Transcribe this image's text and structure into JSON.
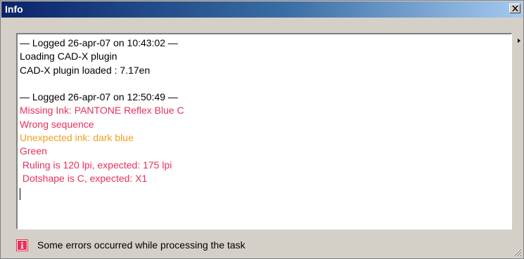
{
  "window": {
    "title": "Info",
    "close_icon": "close-x-icon"
  },
  "log": {
    "lines": [
      {
        "text": "— Logged 26-apr-07 on 10:43:02 —",
        "color": "#000000"
      },
      {
        "text": "Loading CAD-X plugin",
        "color": "#000000"
      },
      {
        "text": "CAD-X plugin loaded : 7.17en",
        "color": "#000000"
      },
      {
        "text": "",
        "color": "#000000"
      },
      {
        "text": "— Logged 26-apr-07 on 12:50:49 —",
        "color": "#000000"
      },
      {
        "text": "Missing Ink: PANTONE Reflex Blue C",
        "color": "#e8305a"
      },
      {
        "text": "Wrong sequence",
        "color": "#e8305a"
      },
      {
        "text": "Unexpected ink: dark blue",
        "color": "#f0a020"
      },
      {
        "text": "Green",
        "color": "#e8305a"
      },
      {
        "text": " Ruling is 120 lpi, expected: 175 lpi",
        "color": "#e8305a"
      },
      {
        "text": " Dotshape is C, expected: X1",
        "color": "#e8305a"
      }
    ]
  },
  "status": {
    "icon": "error-info-icon",
    "message": "Some errors occurred while processing the task"
  },
  "colors": {
    "titlebar_start": "#0a246a",
    "titlebar_end": "#a6caf0",
    "error": "#e8305a",
    "warning": "#f0a020"
  }
}
